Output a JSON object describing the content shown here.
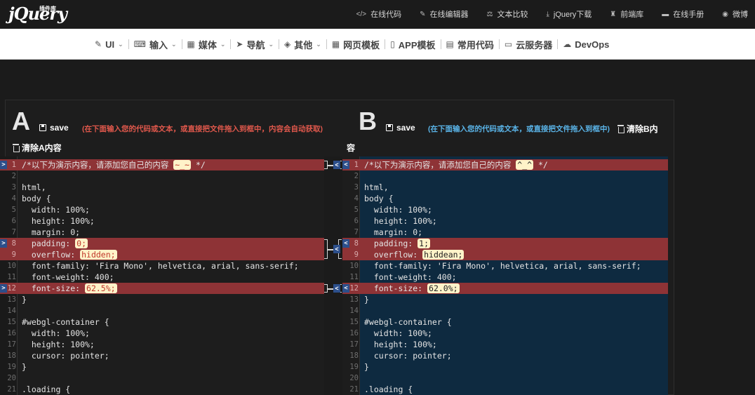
{
  "header": {
    "logo_text": "jQuery",
    "logo_badge": "插件库",
    "links": [
      {
        "icon": "code-icon",
        "glyph": "</>",
        "label": "在线代码"
      },
      {
        "icon": "edit-icon",
        "glyph": "✎",
        "label": "在线编辑器"
      },
      {
        "icon": "scale-icon",
        "glyph": "⚖",
        "label": "文本比较"
      },
      {
        "icon": "download-icon",
        "glyph": "⤓",
        "label": "jQuery下载"
      },
      {
        "icon": "library-icon",
        "glyph": "♜",
        "label": "前端库"
      },
      {
        "icon": "book-icon",
        "glyph": "▬",
        "label": "在线手册"
      },
      {
        "icon": "weibo-icon",
        "glyph": "◉",
        "label": "微博"
      }
    ]
  },
  "nav": {
    "items": [
      {
        "icon": "brush-icon",
        "glyph": "✎",
        "label": "UI",
        "dropdown": true
      },
      {
        "icon": "keyboard-icon",
        "glyph": "⌨",
        "label": "输入",
        "dropdown": true
      },
      {
        "icon": "film-icon",
        "glyph": "▦",
        "label": "媒体",
        "dropdown": true
      },
      {
        "icon": "navigation-icon",
        "glyph": "➤",
        "label": "导航",
        "dropdown": true
      },
      {
        "icon": "dropbox-icon",
        "glyph": "◈",
        "label": "其他",
        "dropdown": true
      },
      {
        "icon": "grid-icon",
        "glyph": "▦",
        "label": "网页模板",
        "dropdown": false
      },
      {
        "icon": "mobile-icon",
        "glyph": "▯",
        "label": "APP模板",
        "dropdown": false
      },
      {
        "icon": "file-code-icon",
        "glyph": "▤",
        "label": "常用代码",
        "dropdown": false
      },
      {
        "icon": "monitor-icon",
        "glyph": "▭",
        "label": "云服务器",
        "dropdown": false
      },
      {
        "icon": "cloud-icon",
        "glyph": "☁",
        "label": "DevOps",
        "dropdown": false
      }
    ]
  },
  "panel_a": {
    "letter": "A",
    "save_label": "save",
    "hint": "(在下面输入您的代码或文本，或直接把文件拖入到框中，内容会自动获取)",
    "hint_color": "#e0584c",
    "clear_label": "清除A内容"
  },
  "panel_b": {
    "letter": "B",
    "save_label": "save",
    "hint": "(在下面输入您的代码或文本，或直接把文件拖入到框中)",
    "hint_color": "#5ab4e8",
    "clear_label": "清除B内",
    "clear_overflow": "容"
  },
  "editor_a": {
    "lines": [
      {
        "n": "1",
        "pre": "/*以下为演示内容，请添加您自己的内容 ",
        "hl": "~_~",
        "post": " */",
        "diff": true,
        "marker": ">"
      },
      {
        "n": "2",
        "text": "",
        "diff": false
      },
      {
        "n": "3",
        "text": "html,",
        "diff": false
      },
      {
        "n": "4",
        "text": "body {",
        "diff": false
      },
      {
        "n": "5",
        "text": "  width: 100%;",
        "diff": false
      },
      {
        "n": "6",
        "text": "  height: 100%;",
        "diff": false
      },
      {
        "n": "7",
        "text": "  margin: 0;",
        "diff": false
      },
      {
        "n": "8",
        "pre": "  padding: ",
        "hl": "0;",
        "post": "",
        "diff": true,
        "marker": ">"
      },
      {
        "n": "9",
        "pre": "  overflow: ",
        "hl": "hidden;",
        "post": "",
        "diff": true
      },
      {
        "n": "10",
        "text": "  font-family: 'Fira Mono', helvetica, arial, sans-serif;",
        "diff": false
      },
      {
        "n": "11",
        "text": "  font-weight: 400;",
        "diff": false
      },
      {
        "n": "12",
        "pre": "  font-size: ",
        "hl": "62.5%;",
        "post": "",
        "diff": true,
        "marker": ">"
      },
      {
        "n": "13",
        "text": "}",
        "diff": false
      },
      {
        "n": "14",
        "text": "",
        "diff": false
      },
      {
        "n": "15",
        "text": "#webgl-container {",
        "diff": false
      },
      {
        "n": "16",
        "text": "  width: 100%;",
        "diff": false
      },
      {
        "n": "17",
        "text": "  height: 100%;",
        "diff": false
      },
      {
        "n": "18",
        "text": "  cursor: pointer;",
        "diff": false
      },
      {
        "n": "19",
        "text": "}",
        "diff": false
      },
      {
        "n": "20",
        "text": "",
        "diff": false
      },
      {
        "n": "21",
        "text": ".loading {",
        "diff": false
      }
    ]
  },
  "editor_b": {
    "lines": [
      {
        "n": "1",
        "pre": "/*以下为演示内容，请添加您自己的内容 ",
        "hl": "^_^",
        "post": " */",
        "diff": true,
        "marker": "<"
      },
      {
        "n": "2",
        "text": "",
        "diff": false
      },
      {
        "n": "3",
        "text": "html,",
        "diff": false
      },
      {
        "n": "4",
        "text": "body {",
        "diff": false
      },
      {
        "n": "5",
        "text": "  width: 100%;",
        "diff": false
      },
      {
        "n": "6",
        "text": "  height: 100%;",
        "diff": false
      },
      {
        "n": "7",
        "text": "  margin: 0;",
        "diff": false
      },
      {
        "n": "8",
        "pre": "  padding: ",
        "hl": "1;",
        "post": "",
        "diff": true,
        "marker": "<"
      },
      {
        "n": "9",
        "pre": "  overflow: ",
        "hl": "hiddean;",
        "post": "",
        "diff": true
      },
      {
        "n": "10",
        "text": "  font-family: 'Fira Mono', helvetica, arial, sans-serif;",
        "diff": false
      },
      {
        "n": "11",
        "text": "  font-weight: 400;",
        "diff": false
      },
      {
        "n": "12",
        "pre": "  font-size: ",
        "hl": "62.0%;",
        "post": "",
        "diff": true,
        "marker": "<"
      },
      {
        "n": "13",
        "text": "}",
        "diff": false
      },
      {
        "n": "14",
        "text": "",
        "diff": false
      },
      {
        "n": "15",
        "text": "#webgl-container {",
        "diff": false
      },
      {
        "n": "16",
        "text": "  width: 100%;",
        "diff": false
      },
      {
        "n": "17",
        "text": "  height: 100%;",
        "diff": false
      },
      {
        "n": "18",
        "text": "  cursor: pointer;",
        "diff": false
      },
      {
        "n": "19",
        "text": "}",
        "diff": false
      },
      {
        "n": "20",
        "text": "",
        "diff": false
      },
      {
        "n": "21",
        "text": ".loading {",
        "diff": false
      }
    ]
  },
  "merge_markers": [
    "<",
    "<",
    "<"
  ]
}
